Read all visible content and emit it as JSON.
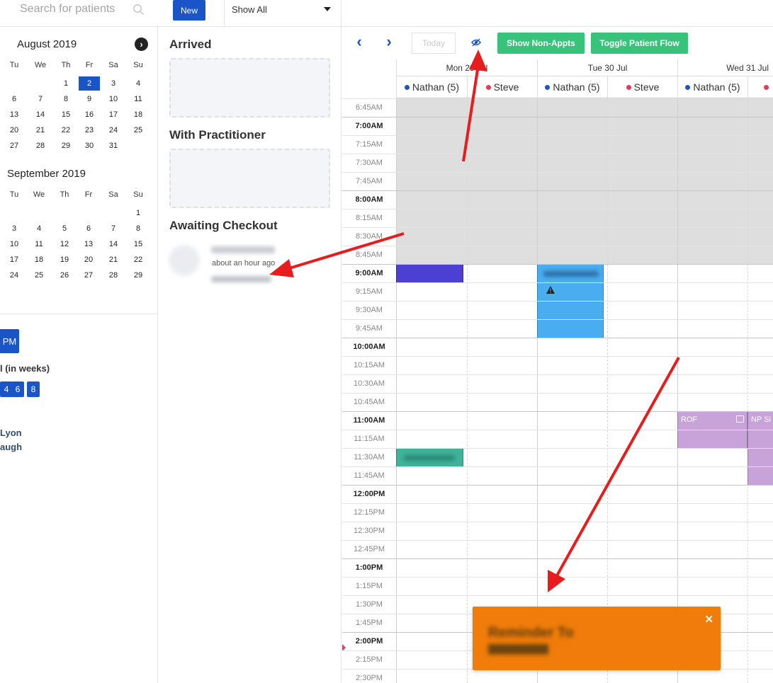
{
  "topbar": {
    "search_placeholder": "Search for patients",
    "new_label": "New",
    "filter_value": "Show All"
  },
  "mini_calendar": {
    "weekdays": [
      "Tu",
      "We",
      "Th",
      "Fr",
      "Sa",
      "Su"
    ],
    "months": [
      {
        "title": "August 2019",
        "rows": [
          [
            "",
            "",
            "1",
            "2",
            "3",
            "4"
          ],
          [
            "6",
            "7",
            "8",
            "9",
            "10",
            "11"
          ],
          [
            "13",
            "14",
            "15",
            "16",
            "17",
            "18"
          ],
          [
            "20",
            "21",
            "22",
            "23",
            "24",
            "25"
          ],
          [
            "27",
            "28",
            "29",
            "30",
            "31",
            ""
          ]
        ],
        "selected_day": "2"
      },
      {
        "title": "September 2019",
        "rows": [
          [
            "",
            "",
            "",
            "",
            "",
            "1"
          ],
          [
            "3",
            "4",
            "5",
            "6",
            "7",
            "8"
          ],
          [
            "10",
            "11",
            "12",
            "13",
            "14",
            "15"
          ],
          [
            "17",
            "18",
            "19",
            "20",
            "21",
            "22"
          ],
          [
            "24",
            "25",
            "26",
            "27",
            "28",
            "29"
          ]
        ]
      }
    ],
    "next_icon": "chevron-right-icon",
    "pm_label": "PM",
    "weeks_label": "l (in weeks)",
    "week_options": [
      "4",
      "6",
      "8"
    ],
    "practitioners": [
      "Lyon",
      "augh"
    ]
  },
  "patient_flow": {
    "arrived_label": "Arrived",
    "with_practitioner_label": "With Practitioner",
    "awaiting_checkout_label": "Awaiting Checkout",
    "awaiting_patient": {
      "time_ago": "about an hour ago"
    }
  },
  "calendar": {
    "today_label": "Today",
    "show_non_appts_label": "Show Non-Appts",
    "toggle_flow_label": "Toggle Patient Flow",
    "colors": {
      "nathan": "#1a54c9",
      "steve": "#e13d5b",
      "green": "#37c37a",
      "accent": "#1a54c9"
    },
    "days": [
      {
        "label": "Mon 29 Jul",
        "practitioners": [
          "Nathan (5)",
          "Steve"
        ]
      },
      {
        "label": "Tue 30 Jul",
        "practitioners": [
          "Nathan (5)",
          "Steve"
        ]
      },
      {
        "label": "Wed 31 Jul",
        "practitioners": [
          "Nathan (5)",
          "Steve"
        ]
      }
    ],
    "times": [
      "6:45AM",
      "7:00AM",
      "7:15AM",
      "7:30AM",
      "7:45AM",
      "8:00AM",
      "8:15AM",
      "8:30AM",
      "8:45AM",
      "9:00AM",
      "9:15AM",
      "9:30AM",
      "9:45AM",
      "10:00AM",
      "10:15AM",
      "10:30AM",
      "10:45AM",
      "11:00AM",
      "11:15AM",
      "11:30AM",
      "11:45AM",
      "12:00PM",
      "12:15PM",
      "12:30PM",
      "12:45PM",
      "1:00PM",
      "1:15PM",
      "1:30PM",
      "1:45PM",
      "2:00PM",
      "2:15PM",
      "2:30PM"
    ],
    "appointments": [
      {
        "label": "ROF"
      },
      {
        "label": "NP Si"
      }
    ]
  },
  "reminder_toast": {
    "title": "Reminder To",
    "close_icon": "close-icon"
  }
}
